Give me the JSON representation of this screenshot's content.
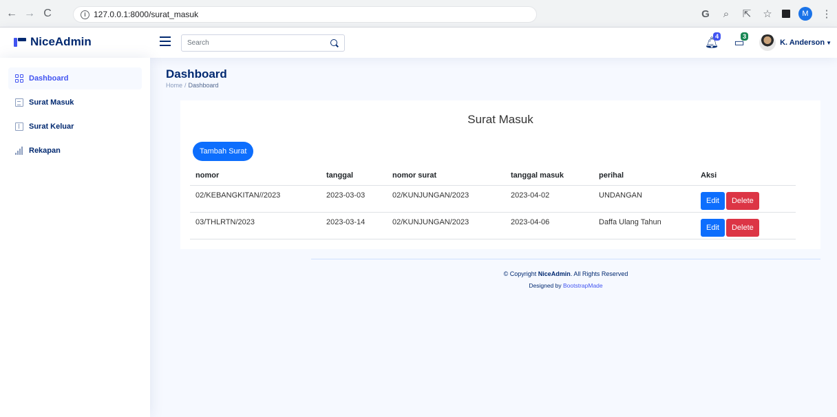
{
  "browser": {
    "url": "127.0.0.1:8000/surat_masuk",
    "profile_initial": "M"
  },
  "header": {
    "logo_text": "NiceAdmin",
    "search_placeholder": "Search",
    "notifications_count": "4",
    "messages_count": "3",
    "user_name": "K. Anderson"
  },
  "sidebar": {
    "items": [
      {
        "label": "Dashboard",
        "icon": "grid-icon",
        "active": true
      },
      {
        "label": "Surat Masuk",
        "icon": "document-icon",
        "active": false
      },
      {
        "label": "Surat Keluar",
        "icon": "layout-icon",
        "active": false
      },
      {
        "label": "Rekapan",
        "icon": "bar-chart-icon",
        "active": false
      }
    ]
  },
  "page": {
    "title": "Dashboard",
    "breadcrumb": [
      "Home",
      "Dashboard"
    ]
  },
  "card": {
    "title": "Surat Masuk",
    "add_button": "Tambah Surat",
    "columns": [
      "nomor",
      "tanggal",
      "nomor surat",
      "tanggal masuk",
      "perihal",
      "Aksi"
    ],
    "rows": [
      {
        "nomor": "02/KEBANGKITAN//2023",
        "tanggal": "2023-03-03",
        "nomor_surat": "02/KUNJUNGAN/2023",
        "tanggal_masuk": "2023-04-02",
        "perihal": "UNDANGAN"
      },
      {
        "nomor": "03/THLRTN/2023",
        "tanggal": "2023-03-14",
        "nomor_surat": "02/KUNJUNGAN/2023",
        "tanggal_masuk": "2023-04-06",
        "perihal": "Daffa Ulang Tahun"
      }
    ],
    "edit_label": "Edit",
    "delete_label": "Delete"
  },
  "footer": {
    "copyright_prefix": "© Copyright ",
    "brand": "NiceAdmin",
    "copyright_suffix": ". All Rights Reserved",
    "designed_by": "Designed by ",
    "designer": "BootstrapMade"
  },
  "colors": {
    "primary": "#4154f1",
    "navy": "#012970",
    "button_blue": "#0d6efd",
    "button_red": "#dc3545"
  }
}
